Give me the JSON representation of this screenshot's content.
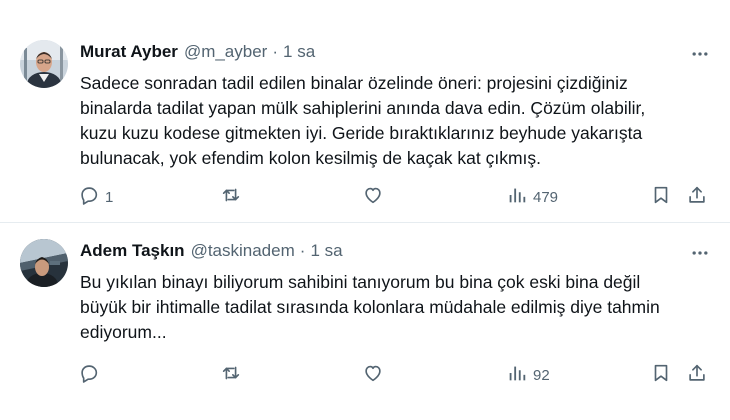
{
  "tweets": [
    {
      "author_name": "Murat Ayber",
      "handle": "@m_ayber",
      "separator": "·",
      "time": "1 sa",
      "text": "Sadece sonradan tadil edilen binalar özelinde öneri: projesini çizdiğiniz\nbinalarda tadilat yapan mülk sahiplerini anında dava edin. Çözüm olabilir,\nkuzu kuzu kodese gitmekten iyi. Geride bıraktıklarınız beyhude yakarışta\nbulunacak, yok efendim kolon kesilmiş de kaçak kat çıkmış.",
      "reply_count": "1",
      "retweet_count": "",
      "like_count": "",
      "view_count": "479",
      "avatar_icon": "user-avatar"
    },
    {
      "author_name": "Adem Taşkın",
      "handle": "@taskinadem",
      "separator": "·",
      "time": "1 sa",
      "text": "Bu yıkılan binayı biliyorum sahibini tanıyorum bu bina çok eski bina değil\nbüyük bir ihtimalle tadilat sırasında kolonlara müdahale edilmiş diye tahmin\nediyorum...",
      "reply_count": "",
      "retweet_count": "",
      "like_count": "",
      "view_count": "92",
      "avatar_icon": "user-avatar"
    }
  ],
  "colors": {
    "text_primary": "#0f1419",
    "text_secondary": "#536471",
    "divider": "#e6ecf0",
    "background": "#ffffff"
  },
  "icons": [
    "more-icon",
    "reply-icon",
    "retweet-icon",
    "like-icon",
    "views-icon",
    "bookmark-icon",
    "share-icon"
  ]
}
